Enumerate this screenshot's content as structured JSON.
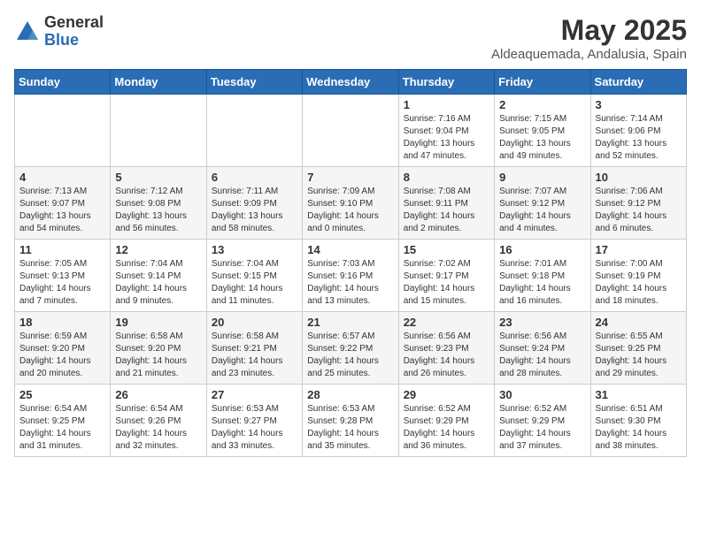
{
  "header": {
    "logo_general": "General",
    "logo_blue": "Blue",
    "month_title": "May 2025",
    "location": "Aldeaquemada, Andalusia, Spain"
  },
  "weekdays": [
    "Sunday",
    "Monday",
    "Tuesday",
    "Wednesday",
    "Thursday",
    "Friday",
    "Saturday"
  ],
  "weeks": [
    [
      {
        "day": "",
        "sunrise": "",
        "sunset": "",
        "daylight": ""
      },
      {
        "day": "",
        "sunrise": "",
        "sunset": "",
        "daylight": ""
      },
      {
        "day": "",
        "sunrise": "",
        "sunset": "",
        "daylight": ""
      },
      {
        "day": "",
        "sunrise": "",
        "sunset": "",
        "daylight": ""
      },
      {
        "day": "1",
        "sunrise": "Sunrise: 7:16 AM",
        "sunset": "Sunset: 9:04 PM",
        "daylight": "Daylight: 13 hours and 47 minutes."
      },
      {
        "day": "2",
        "sunrise": "Sunrise: 7:15 AM",
        "sunset": "Sunset: 9:05 PM",
        "daylight": "Daylight: 13 hours and 49 minutes."
      },
      {
        "day": "3",
        "sunrise": "Sunrise: 7:14 AM",
        "sunset": "Sunset: 9:06 PM",
        "daylight": "Daylight: 13 hours and 52 minutes."
      }
    ],
    [
      {
        "day": "4",
        "sunrise": "Sunrise: 7:13 AM",
        "sunset": "Sunset: 9:07 PM",
        "daylight": "Daylight: 13 hours and 54 minutes."
      },
      {
        "day": "5",
        "sunrise": "Sunrise: 7:12 AM",
        "sunset": "Sunset: 9:08 PM",
        "daylight": "Daylight: 13 hours and 56 minutes."
      },
      {
        "day": "6",
        "sunrise": "Sunrise: 7:11 AM",
        "sunset": "Sunset: 9:09 PM",
        "daylight": "Daylight: 13 hours and 58 minutes."
      },
      {
        "day": "7",
        "sunrise": "Sunrise: 7:09 AM",
        "sunset": "Sunset: 9:10 PM",
        "daylight": "Daylight: 14 hours and 0 minutes."
      },
      {
        "day": "8",
        "sunrise": "Sunrise: 7:08 AM",
        "sunset": "Sunset: 9:11 PM",
        "daylight": "Daylight: 14 hours and 2 minutes."
      },
      {
        "day": "9",
        "sunrise": "Sunrise: 7:07 AM",
        "sunset": "Sunset: 9:12 PM",
        "daylight": "Daylight: 14 hours and 4 minutes."
      },
      {
        "day": "10",
        "sunrise": "Sunrise: 7:06 AM",
        "sunset": "Sunset: 9:12 PM",
        "daylight": "Daylight: 14 hours and 6 minutes."
      }
    ],
    [
      {
        "day": "11",
        "sunrise": "Sunrise: 7:05 AM",
        "sunset": "Sunset: 9:13 PM",
        "daylight": "Daylight: 14 hours and 7 minutes."
      },
      {
        "day": "12",
        "sunrise": "Sunrise: 7:04 AM",
        "sunset": "Sunset: 9:14 PM",
        "daylight": "Daylight: 14 hours and 9 minutes."
      },
      {
        "day": "13",
        "sunrise": "Sunrise: 7:04 AM",
        "sunset": "Sunset: 9:15 PM",
        "daylight": "Daylight: 14 hours and 11 minutes."
      },
      {
        "day": "14",
        "sunrise": "Sunrise: 7:03 AM",
        "sunset": "Sunset: 9:16 PM",
        "daylight": "Daylight: 14 hours and 13 minutes."
      },
      {
        "day": "15",
        "sunrise": "Sunrise: 7:02 AM",
        "sunset": "Sunset: 9:17 PM",
        "daylight": "Daylight: 14 hours and 15 minutes."
      },
      {
        "day": "16",
        "sunrise": "Sunrise: 7:01 AM",
        "sunset": "Sunset: 9:18 PM",
        "daylight": "Daylight: 14 hours and 16 minutes."
      },
      {
        "day": "17",
        "sunrise": "Sunrise: 7:00 AM",
        "sunset": "Sunset: 9:19 PM",
        "daylight": "Daylight: 14 hours and 18 minutes."
      }
    ],
    [
      {
        "day": "18",
        "sunrise": "Sunrise: 6:59 AM",
        "sunset": "Sunset: 9:20 PM",
        "daylight": "Daylight: 14 hours and 20 minutes."
      },
      {
        "day": "19",
        "sunrise": "Sunrise: 6:58 AM",
        "sunset": "Sunset: 9:20 PM",
        "daylight": "Daylight: 14 hours and 21 minutes."
      },
      {
        "day": "20",
        "sunrise": "Sunrise: 6:58 AM",
        "sunset": "Sunset: 9:21 PM",
        "daylight": "Daylight: 14 hours and 23 minutes."
      },
      {
        "day": "21",
        "sunrise": "Sunrise: 6:57 AM",
        "sunset": "Sunset: 9:22 PM",
        "daylight": "Daylight: 14 hours and 25 minutes."
      },
      {
        "day": "22",
        "sunrise": "Sunrise: 6:56 AM",
        "sunset": "Sunset: 9:23 PM",
        "daylight": "Daylight: 14 hours and 26 minutes."
      },
      {
        "day": "23",
        "sunrise": "Sunrise: 6:56 AM",
        "sunset": "Sunset: 9:24 PM",
        "daylight": "Daylight: 14 hours and 28 minutes."
      },
      {
        "day": "24",
        "sunrise": "Sunrise: 6:55 AM",
        "sunset": "Sunset: 9:25 PM",
        "daylight": "Daylight: 14 hours and 29 minutes."
      }
    ],
    [
      {
        "day": "25",
        "sunrise": "Sunrise: 6:54 AM",
        "sunset": "Sunset: 9:25 PM",
        "daylight": "Daylight: 14 hours and 31 minutes."
      },
      {
        "day": "26",
        "sunrise": "Sunrise: 6:54 AM",
        "sunset": "Sunset: 9:26 PM",
        "daylight": "Daylight: 14 hours and 32 minutes."
      },
      {
        "day": "27",
        "sunrise": "Sunrise: 6:53 AM",
        "sunset": "Sunset: 9:27 PM",
        "daylight": "Daylight: 14 hours and 33 minutes."
      },
      {
        "day": "28",
        "sunrise": "Sunrise: 6:53 AM",
        "sunset": "Sunset: 9:28 PM",
        "daylight": "Daylight: 14 hours and 35 minutes."
      },
      {
        "day": "29",
        "sunrise": "Sunrise: 6:52 AM",
        "sunset": "Sunset: 9:29 PM",
        "daylight": "Daylight: 14 hours and 36 minutes."
      },
      {
        "day": "30",
        "sunrise": "Sunrise: 6:52 AM",
        "sunset": "Sunset: 9:29 PM",
        "daylight": "Daylight: 14 hours and 37 minutes."
      },
      {
        "day": "31",
        "sunrise": "Sunrise: 6:51 AM",
        "sunset": "Sunset: 9:30 PM",
        "daylight": "Daylight: 14 hours and 38 minutes."
      }
    ]
  ]
}
